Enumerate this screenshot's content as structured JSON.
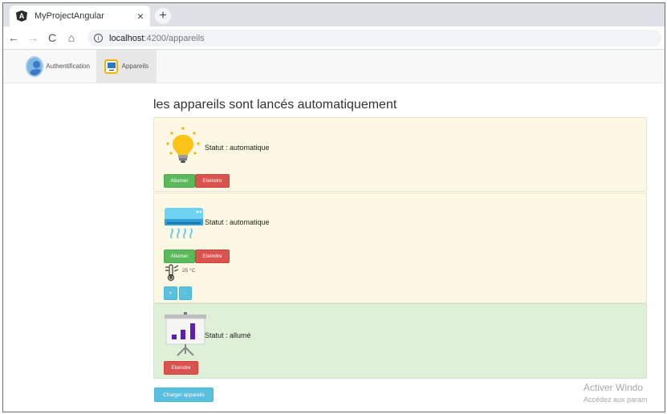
{
  "browser": {
    "tab_title": "MyProjectAngular",
    "tab_close": "×",
    "new_tab": "+",
    "nav": {
      "back": "←",
      "forward": "→",
      "reload": "C",
      "home": "⌂"
    },
    "url_info": "i",
    "url_host": "localhost",
    "url_path": ":4200/appareils"
  },
  "app_nav": {
    "items": [
      {
        "label": "Authentification",
        "icon": "avatar-icon",
        "active": false
      },
      {
        "label": "Appareils",
        "icon": "monitor-icon",
        "active": true
      }
    ]
  },
  "main": {
    "title": "les appareils sont lancés automatiquement",
    "devices": [
      {
        "icon": "lightbulb-icon",
        "status": "Statut : automatique",
        "buttons": [
          "Allumer",
          "Eteindre"
        ]
      },
      {
        "icon": "air-conditioner-icon",
        "status": "Statut : automatique",
        "buttons": [
          "Allumer",
          "Eteindre"
        ],
        "temperature": "25 °C",
        "temp_buttons": [
          "+",
          "-"
        ]
      },
      {
        "icon": "presentation-board-icon",
        "status": "Statut : allumé",
        "buttons": [
          "Eteindre"
        ]
      }
    ],
    "load_button": "Charger appareils"
  },
  "watermark": {
    "line1": "Activer Windo",
    "line2": "Accédez aux param"
  },
  "colors": {
    "panel_off_bg": "#fcf8e3",
    "panel_on_bg": "#dff0d8",
    "success": "#5cb85c",
    "danger": "#d9534f",
    "info": "#5bc0de"
  }
}
